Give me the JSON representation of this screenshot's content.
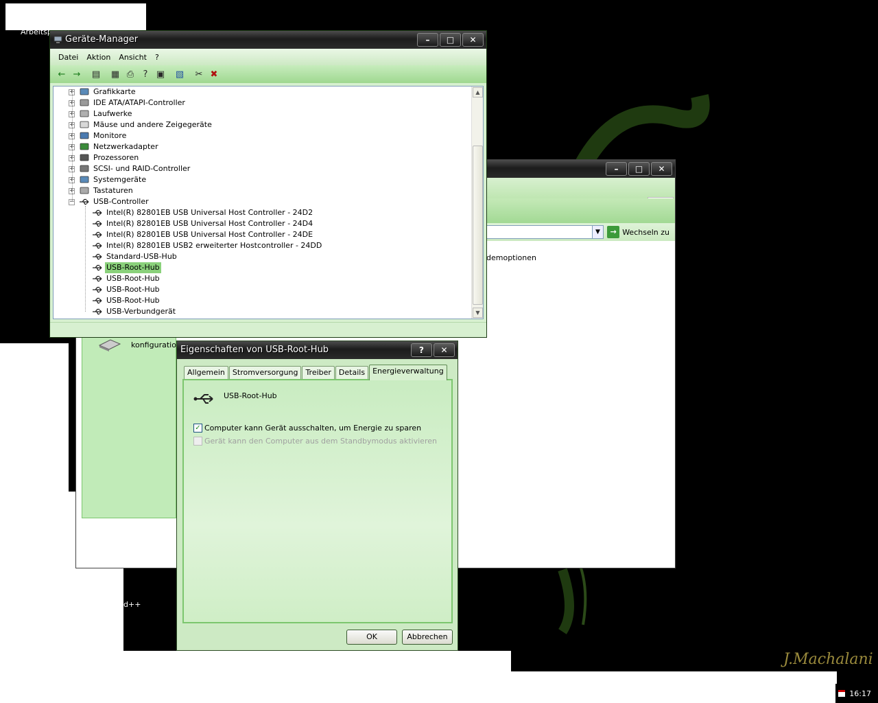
{
  "desktop": {
    "icon_label": "Arbeitspl",
    "partial_texts": [
      "d++"
    ],
    "signature": "J.Machalani",
    "clock": "16:17"
  },
  "devmgr": {
    "title": "Geräte-Manager",
    "menu": [
      "Datei",
      "Aktion",
      "Ansicht",
      "?"
    ],
    "toolbar_icons": [
      "back-arrow-icon",
      "forward-arrow-icon",
      "sep",
      "tree-view-icon",
      "sep",
      "properties-icon",
      "print-icon",
      "help-icon",
      "show-hidden-icon",
      "sep",
      "scan-hardware-icon",
      "sep",
      "uninstall-icon",
      "disable-device-icon"
    ],
    "tree": [
      {
        "label": "Grafikkarte",
        "level": 0,
        "expander": "+",
        "icon": "display-adapter-icon"
      },
      {
        "label": "IDE ATA/ATAPI-Controller",
        "level": 0,
        "expander": "+",
        "icon": "ide-controller-icon"
      },
      {
        "label": "Laufwerke",
        "level": 0,
        "expander": "+",
        "icon": "disk-drive-icon"
      },
      {
        "label": "Mäuse und andere Zeigegeräte",
        "level": 0,
        "expander": "+",
        "icon": "mouse-icon"
      },
      {
        "label": "Monitore",
        "level": 0,
        "expander": "+",
        "icon": "monitor-icon"
      },
      {
        "label": "Netzwerkadapter",
        "level": 0,
        "expander": "+",
        "icon": "network-adapter-icon"
      },
      {
        "label": "Prozessoren",
        "level": 0,
        "expander": "+",
        "icon": "processor-icon"
      },
      {
        "label": "SCSI- und RAID-Controller",
        "level": 0,
        "expander": "+",
        "icon": "scsi-icon"
      },
      {
        "label": "Systemgeräte",
        "level": 0,
        "expander": "+",
        "icon": "system-device-icon"
      },
      {
        "label": "Tastaturen",
        "level": 0,
        "expander": "+",
        "icon": "keyboard-icon"
      },
      {
        "label": "USB-Controller",
        "level": 0,
        "expander": "−",
        "icon": "usb-icon"
      },
      {
        "label": "Intel(R) 82801EB USB Universal Host Controller - 24D2",
        "level": 1,
        "icon": "usb-icon"
      },
      {
        "label": "Intel(R) 82801EB USB Universal Host Controller - 24D4",
        "level": 1,
        "icon": "usb-icon"
      },
      {
        "label": "Intel(R) 82801EB USB Universal Host Controller - 24DE",
        "level": 1,
        "icon": "usb-icon"
      },
      {
        "label": "Intel(R) 82801EB USB2 erweiterter Hostcontroller - 24DD",
        "level": 1,
        "icon": "usb-icon"
      },
      {
        "label": "Standard-USB-Hub",
        "level": 1,
        "icon": "usb-icon"
      },
      {
        "label": "USB-Root-Hub",
        "level": 1,
        "icon": "usb-icon",
        "selected": true
      },
      {
        "label": "USB-Root-Hub",
        "level": 1,
        "icon": "usb-icon"
      },
      {
        "label": "USB-Root-Hub",
        "level": 1,
        "icon": "usb-icon"
      },
      {
        "label": "USB-Root-Hub",
        "level": 1,
        "icon": "usb-icon"
      },
      {
        "label": "USB-Verbundgerät",
        "level": 1,
        "icon": "usb-icon"
      }
    ]
  },
  "bgwin": {
    "go_label": "Wechseln zu",
    "text_1": "demoptionen",
    "text_2": "konfiguratione"
  },
  "props": {
    "title": "Eigenschaften von USB-Root-Hub",
    "tabs": [
      "Allgemein",
      "Stromversorgung",
      "Treiber",
      "Details",
      "Energieverwaltung"
    ],
    "active_tab": 4,
    "device_name": "USB-Root-Hub",
    "option_1": "Computer kann Gerät ausschalten, um Energie zu sparen",
    "option_1_checked": true,
    "option_2": "Gerät kann den Computer aus dem Standbymodus aktivieren",
    "option_2_checked": false,
    "ok": "OK",
    "cancel": "Abbrechen"
  },
  "colors": {
    "accent_green": "#8ad17b",
    "titlebar_dark": "#1c1c1c"
  }
}
